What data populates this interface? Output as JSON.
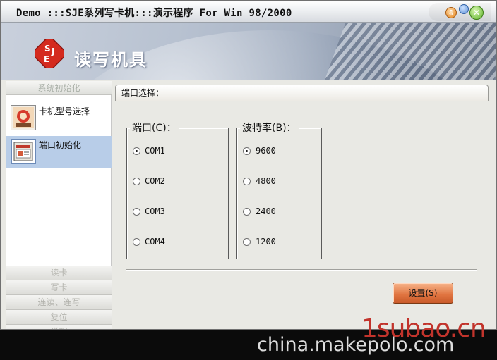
{
  "window": {
    "title": "Demo :::SJE系列写卡机:::演示程序  For Win 98/2000"
  },
  "title_buttons": {
    "minimize": "⇩",
    "close": "✕"
  },
  "banner": {
    "logo_letters": "SJE",
    "title": "读写机具"
  },
  "sidebar": {
    "section_header": "系统初始化",
    "items": [
      {
        "label": "卡机型号选择",
        "icon": "card-reader-icon"
      },
      {
        "label": "端口初始化",
        "icon": "port-config-icon"
      }
    ],
    "bottom_sections": [
      "读卡",
      "写卡",
      "连读、连写",
      "复位",
      "说明"
    ]
  },
  "content": {
    "header": "端口选择：",
    "port_group": {
      "legend": "端口(C)：",
      "options": [
        "COM1",
        "COM2",
        "COM3",
        "COM4"
      ],
      "selected": "COM1"
    },
    "baud_group": {
      "legend": "波特率(B)：",
      "options": [
        "9600",
        "4800",
        "2400",
        "1200"
      ],
      "selected": "9600"
    },
    "set_button": "设置(S)"
  },
  "watermarks": {
    "primary": "1subao.cn",
    "secondary": "china.makepolo.com"
  },
  "colors": {
    "accent_button": "#e0733f",
    "sidebar_active": "#b8cde8",
    "logo_red": "#d42a1e"
  }
}
